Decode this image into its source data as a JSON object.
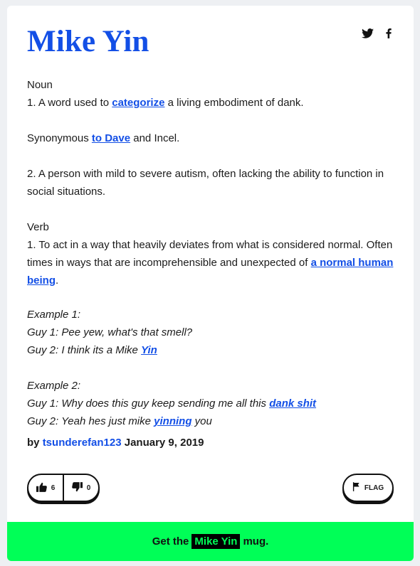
{
  "entry": {
    "word": "Mike Yin",
    "meaning": {
      "p1_line1": "Noun",
      "p1_line2_a": "1. A word used to ",
      "p1_line2_link": "categorize",
      "p1_line2_b": " a living embodiment of dank.",
      "p2_a": "Synonymous ",
      "p2_link": "to Dave",
      "p2_b": " and Incel.",
      "p3": "2. A person with mild to severe autism, often lacking the ability to function in social situations.",
      "p4_line1": "Verb",
      "p4_line2_a": "1. To act in a way that heavily deviates from what is considered normal. Often times in ways that are incomprehensible and unexpected of ",
      "p4_line2_link": "a normal human being",
      "p4_line2_b": "."
    },
    "example": {
      "e1_title": "Example 1:",
      "e1_l1": "Guy 1: Pee yew, what's that smell?",
      "e1_l2_a": "Guy 2: I think its a Mike ",
      "e1_l2_link": "Yin",
      "e2_title": "Example 2:",
      "e2_l1_a": "Guy 1: Why does this guy keep sending me all this ",
      "e2_l1_link": "dank shit",
      "e2_l2_a": "Guy 2: Yeah hes just mike ",
      "e2_l2_link": "yinning",
      "e2_l2_b": " you"
    },
    "contributor": {
      "by": "by ",
      "author": "tsunderefan123",
      "date": " January 9, 2019"
    },
    "votes": {
      "up": "6",
      "down": "0"
    },
    "flag_label": "FLAG",
    "mug": {
      "pre": "Get the",
      "word": "Mike Yin",
      "post": "mug."
    }
  },
  "icons": {
    "share_twitter": "twitter-icon",
    "share_facebook": "facebook-icon",
    "thumb_up": "thumbs-up-icon",
    "thumb_down": "thumbs-down-icon",
    "flag": "flag-icon"
  },
  "colors": {
    "accent": "#134fe6",
    "mug_bg": "#00ff57"
  }
}
